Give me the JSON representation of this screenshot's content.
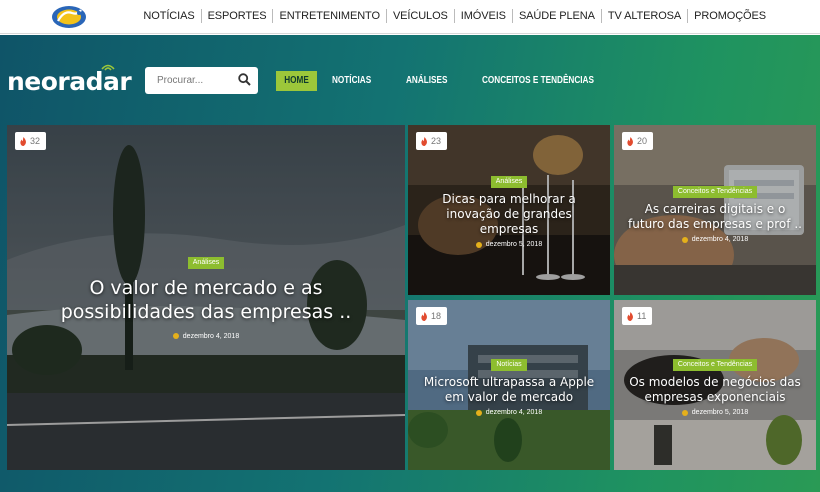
{
  "topbar": {
    "nav": [
      "NOTÍCIAS",
      "ESPORTES",
      "ENTRETENIMENTO",
      "VEÍCULOS",
      "IMÓVEIS",
      "SAÚDE PLENA",
      "TV ALTEROSA",
      "PROMOÇÕES"
    ]
  },
  "header": {
    "brand": "neoradar",
    "search_placeholder": "Procurar...",
    "nav": [
      "HOME",
      "NOTÍCIAS",
      "ANÁLISES",
      "CONCEITOS E TENDÊNCIAS"
    ]
  },
  "colors": {
    "accent": "#9cc73a",
    "tag": "#8dbd2f",
    "clock": "#e5b01b"
  },
  "cards": [
    {
      "count": "32",
      "tag": "Análises",
      "title_line1": "O valor de mercado e as",
      "title_line2": "possibilidades das empresas ..",
      "date": "dezembro 4, 2018"
    },
    {
      "count": "23",
      "tag": "Análises",
      "title_line1": "Dicas para melhorar a",
      "title_line2": "inovação de grandes",
      "title_line3": "empresas",
      "date": "dezembro 5, 2018"
    },
    {
      "count": "20",
      "tag": "Conceitos e Tendências",
      "title_line1": "As carreiras digitais e o",
      "title_line2": "futuro das empresas e prof ..",
      "date": "dezembro 4, 2018"
    },
    {
      "count": "18",
      "tag": "Notícias",
      "title_line1": "Microsoft ultrapassa a Apple",
      "title_line2": "em valor de mercado",
      "date": "dezembro 4, 2018"
    },
    {
      "count": "11",
      "tag": "Conceitos e Tendências",
      "title_line1": "Os modelos de negócios das",
      "title_line2": "empresas exponenciais",
      "date": "dezembro 5, 2018"
    }
  ]
}
